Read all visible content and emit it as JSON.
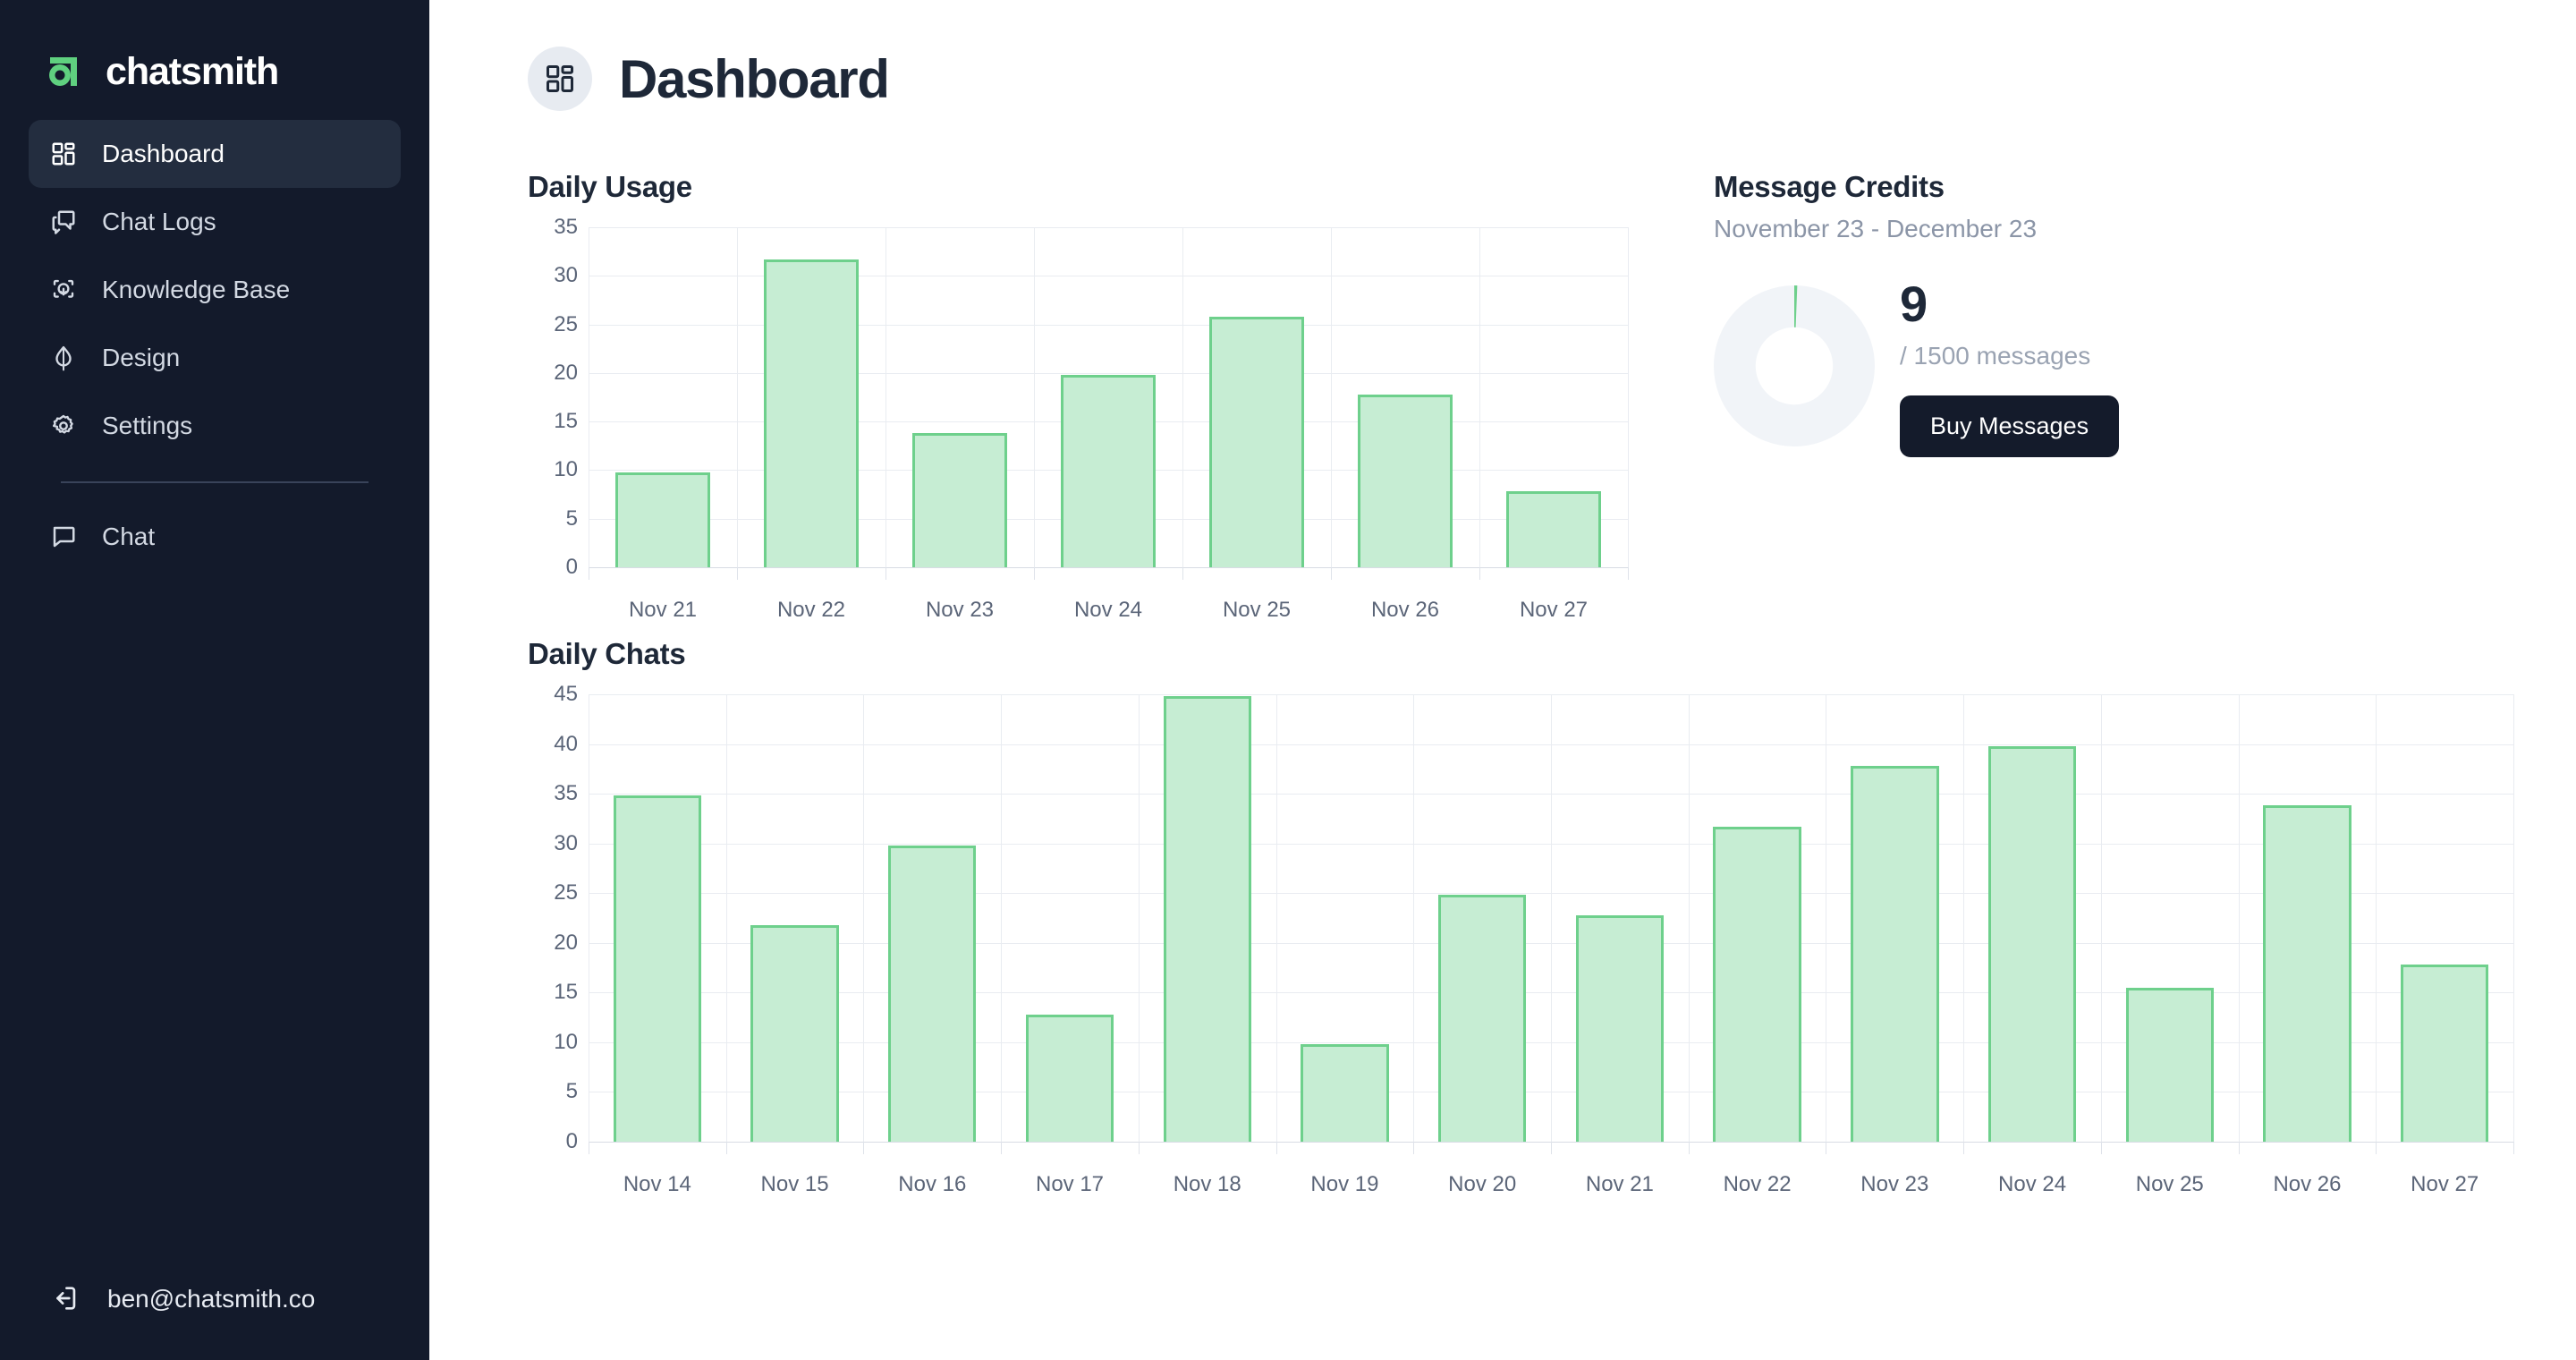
{
  "brand": {
    "name": "chatsmith",
    "logo_icon": "chatsmith-logo-icon",
    "accent": "#5fd07f"
  },
  "sidebar": {
    "items": [
      {
        "label": "Dashboard",
        "icon": "layout-grid-icon",
        "active": true
      },
      {
        "label": "Chat Logs",
        "icon": "message-square-stack-icon",
        "active": false
      },
      {
        "label": "Knowledge Base",
        "icon": "brain-circuit-icon",
        "active": false
      },
      {
        "label": "Design",
        "icon": "droplet-half-icon",
        "active": false
      },
      {
        "label": "Settings",
        "icon": "gear-icon",
        "active": false
      }
    ],
    "secondary_items": [
      {
        "label": "Chat",
        "icon": "message-square-icon"
      }
    ],
    "user": {
      "email": "ben@chatsmith.co",
      "icon": "logout-icon"
    }
  },
  "header": {
    "title": "Dashboard",
    "icon": "layout-grid-icon"
  },
  "daily_usage": {
    "title": "Daily Usage"
  },
  "daily_chats": {
    "title": "Daily Chats"
  },
  "credits": {
    "title": "Message Credits",
    "date_range": "November 23 - December 23",
    "used": "9",
    "total_label": "/ 1500 messages",
    "used_value": 9,
    "total_value": 1500,
    "buy_label": "Buy Messages",
    "track_color": "#f1f4f8",
    "fill_color": "#6ed08c",
    "button_color": "#141b2b"
  },
  "chart_data": [
    {
      "type": "bar",
      "title": "Daily Usage",
      "xlabel": "",
      "ylabel": "",
      "ylim": [
        0,
        35
      ],
      "yticks": [
        0,
        5,
        10,
        15,
        20,
        25,
        30,
        35
      ],
      "grid": true,
      "categories": [
        "Nov 21",
        "Nov 22",
        "Nov 23",
        "Nov 24",
        "Nov 25",
        "Nov 26",
        "Nov 27"
      ],
      "values": [
        9.8,
        31.7,
        13.8,
        19.8,
        25.8,
        17.8,
        7.8
      ],
      "bar_fill": "#c6edd3",
      "bar_stroke": "#6ed08c"
    },
    {
      "type": "bar",
      "title": "Daily Chats",
      "xlabel": "",
      "ylabel": "",
      "ylim": [
        0,
        45
      ],
      "yticks": [
        0,
        5,
        10,
        15,
        20,
        25,
        30,
        35,
        40,
        45
      ],
      "grid": true,
      "categories": [
        "Nov 14",
        "Nov 15",
        "Nov 16",
        "Nov 17",
        "Nov 18",
        "Nov 19",
        "Nov 20",
        "Nov 21",
        "Nov 22",
        "Nov 23",
        "Nov 24",
        "Nov 25",
        "Nov 26",
        "Nov 27"
      ],
      "values": [
        34.8,
        21.8,
        29.8,
        12.8,
        44.8,
        9.8,
        24.8,
        22.8,
        31.7,
        37.8,
        39.8,
        15.5,
        33.8,
        17.8
      ],
      "bar_fill": "#c6edd3",
      "bar_stroke": "#6ed08c"
    }
  ]
}
